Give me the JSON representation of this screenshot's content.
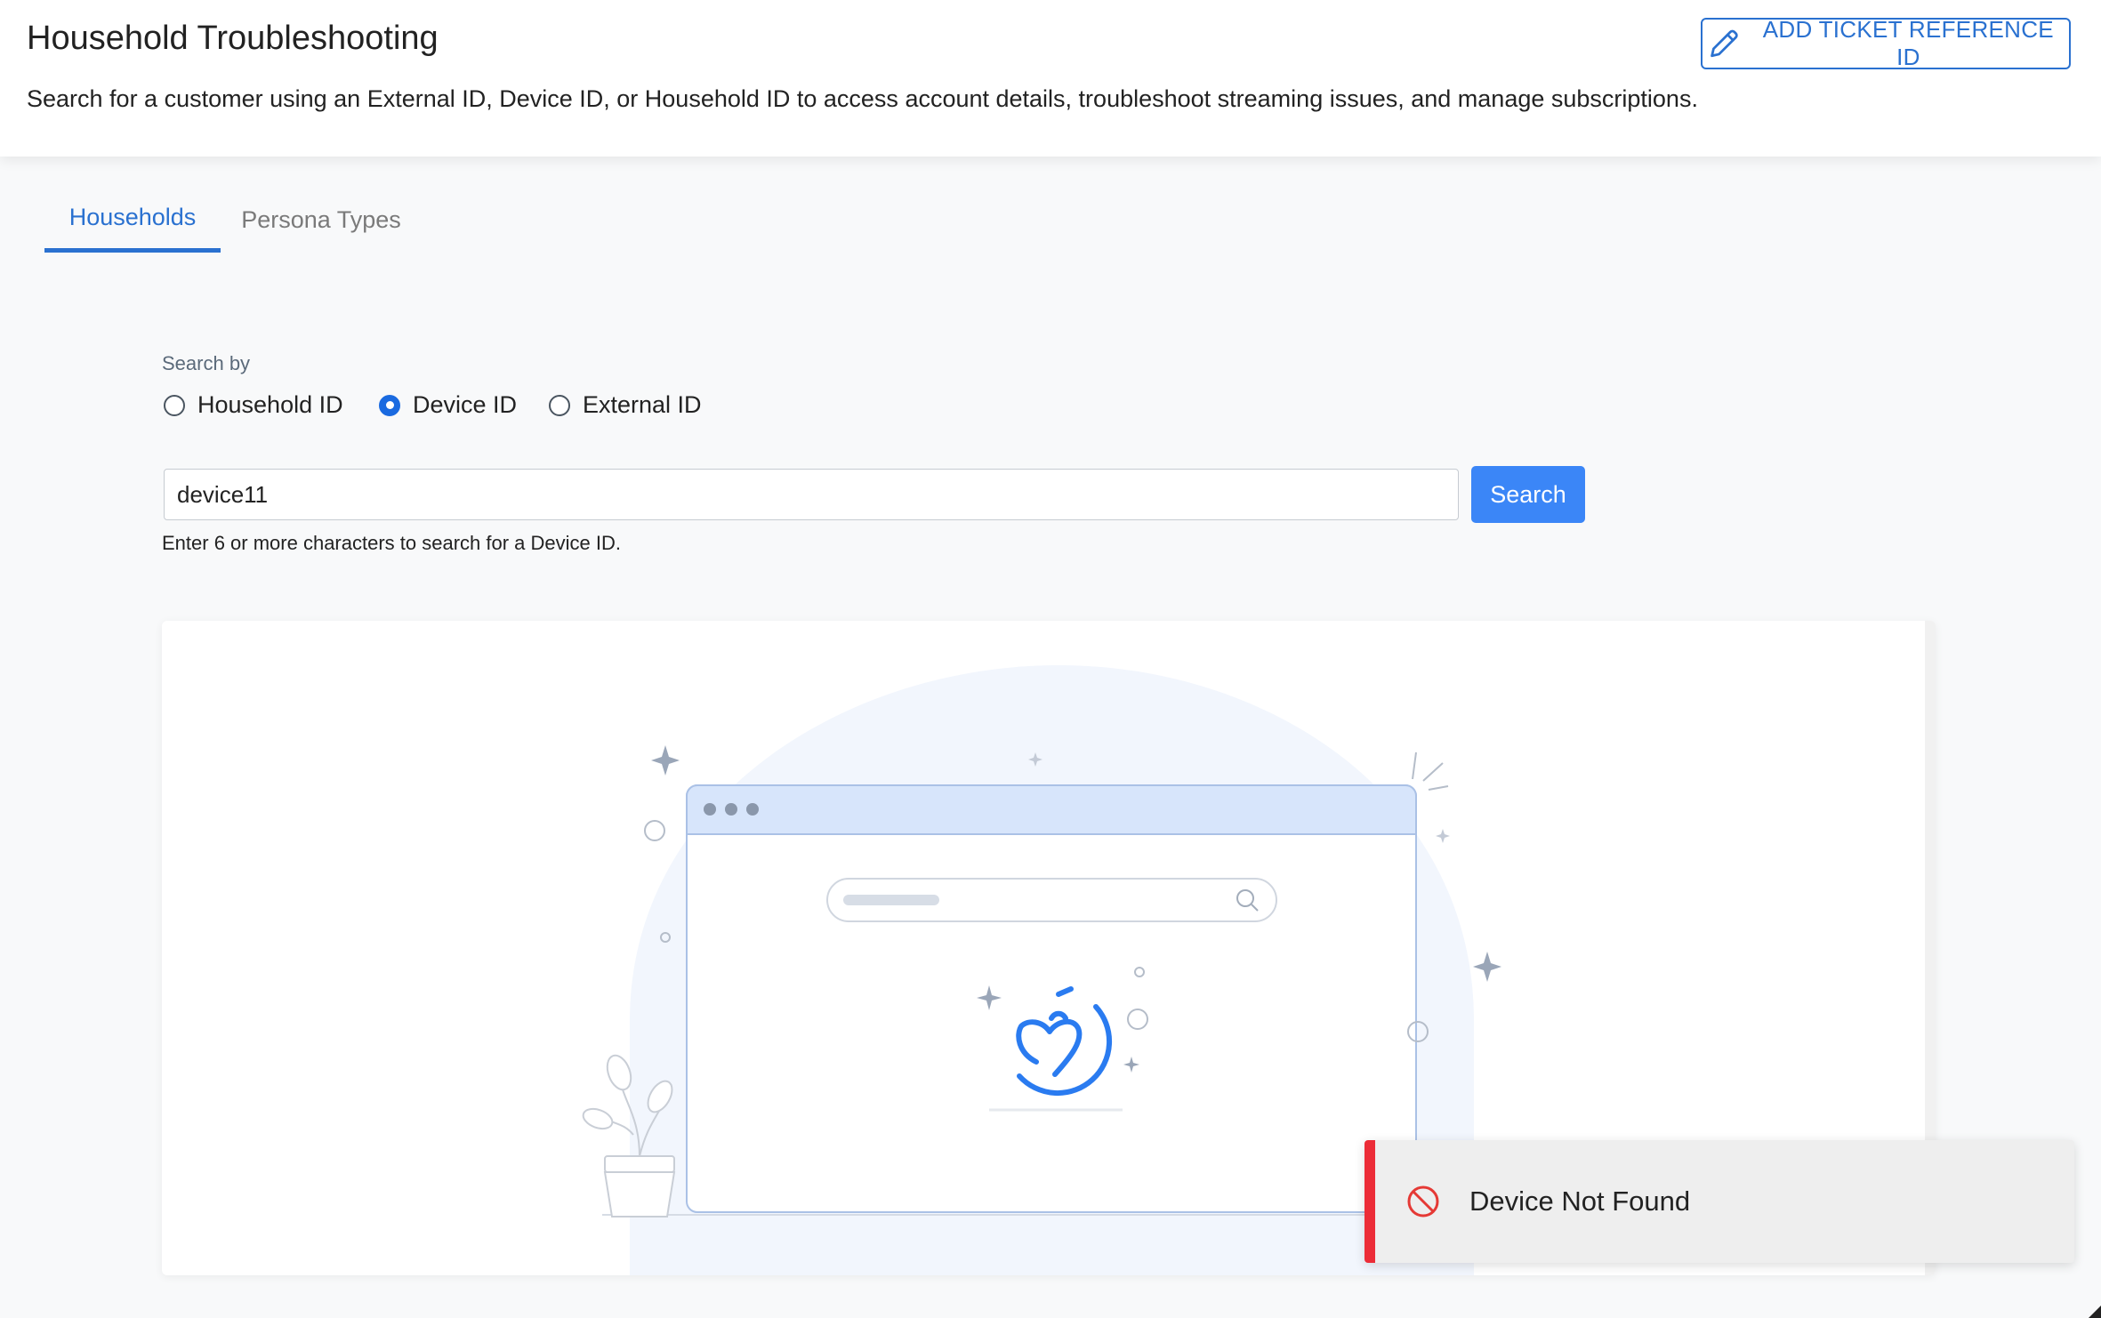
{
  "header": {
    "title": "Household Troubleshooting",
    "description": "Search for a customer using an External ID, Device ID, or Household ID to access account details, troubleshoot streaming issues, and manage subscriptions.",
    "ticket_button_label": "ADD TICKET REFERENCE ID",
    "ticket_button_icon": "pencil-icon"
  },
  "tabs": [
    {
      "label": "Households",
      "active": true
    },
    {
      "label": "Persona Types",
      "active": false
    }
  ],
  "search": {
    "label": "Search by",
    "options": [
      {
        "label": "Household ID",
        "selected": false
      },
      {
        "label": "Device ID",
        "selected": true
      },
      {
        "label": "External ID",
        "selected": false
      }
    ],
    "value": "device11",
    "button_label": "Search",
    "helper_text": "Enter 6 or more characters to search for a Device ID."
  },
  "empty_state": {
    "illustration": "browser-search-thinking-face-illustration"
  },
  "toast": {
    "message": "Device Not Found",
    "icon": "prohibited-icon",
    "accent_color": "#ec2c37"
  },
  "colors": {
    "primary": "#2a71d0",
    "button": "#3b86f7",
    "radio_selected": "#1a6ae0"
  }
}
